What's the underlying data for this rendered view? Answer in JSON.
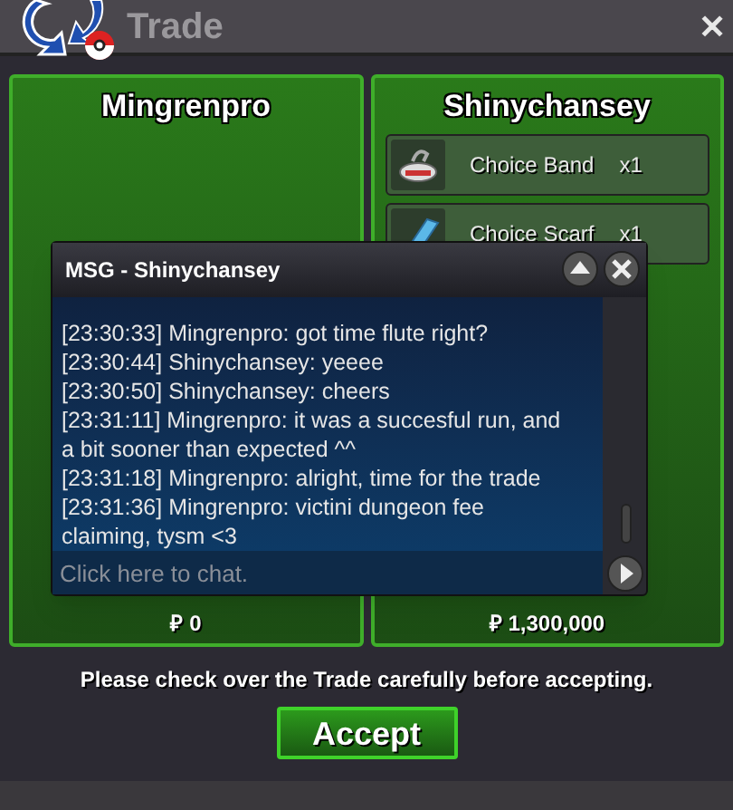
{
  "window": {
    "title": "Trade",
    "close": "✕"
  },
  "panels": [
    {
      "name": "Mingrenpro",
      "money": "₽ 0"
    },
    {
      "name": "Shinychansey",
      "items": [
        {
          "label": "Choice Band",
          "qty": "x1",
          "kind": "band"
        },
        {
          "label": "Choice Scarf",
          "qty": "x1",
          "kind": "scarf"
        }
      ],
      "money": "₽ 1,300,000"
    }
  ],
  "chat": {
    "title": "MSG - Shinychansey",
    "messages": [
      "[23:30:33] Mingrenpro: got time flute right?",
      "[23:30:44] Shinychansey: yeeee",
      "[23:30:50] Shinychansey: cheers",
      "[23:31:11] Mingrenpro: it was a succesful run, and a bit sooner than expected ^^",
      "[23:31:18] Mingrenpro: alright, time for the trade",
      "[23:31:36] Mingrenpro: victini dungeon fee claiming, tysm <3"
    ],
    "placeholder": "Click here to chat."
  },
  "notice": "Please check over the Trade carefully before accepting.",
  "accept_button": "Accept"
}
